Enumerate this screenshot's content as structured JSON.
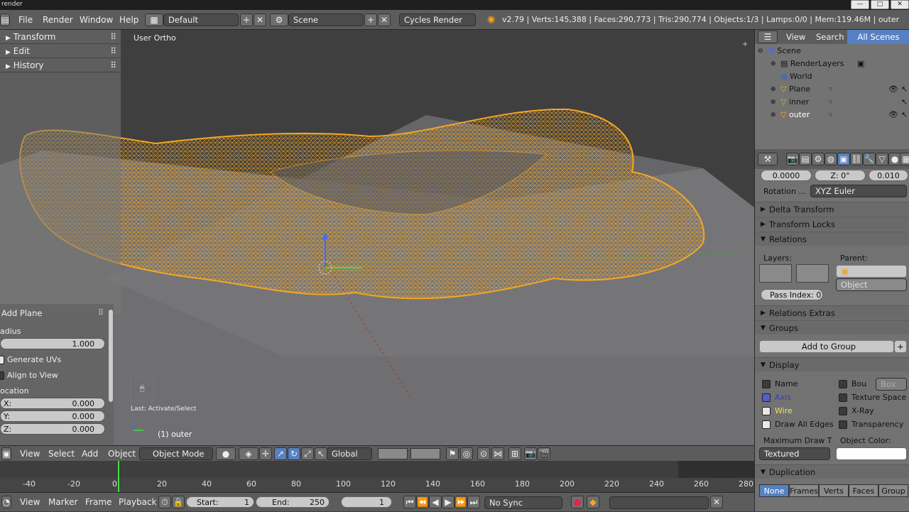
{
  "titlebar": {
    "title": "render"
  },
  "window_buttons": [
    "—",
    "□",
    "✕"
  ],
  "menu": {
    "file": "File",
    "render": "Render",
    "window": "Window",
    "help": "Help"
  },
  "screen_layout": "Default",
  "scene_name": "Scene",
  "render_engine": "Cycles Render",
  "stats": "v2.79 | Verts:145,388 | Faces:290,773 | Tris:290,774 | Objects:1/3 | Lamps:0/0 | Mem:119.46M | outer",
  "toolshelf": {
    "items": [
      "Transform",
      "Edit",
      "History"
    ]
  },
  "viewport": {
    "view_name": "User Ortho",
    "last_op": "Last: Activate/Select",
    "object_label": "(1) outer"
  },
  "redo_panel": {
    "title": "Add Plane",
    "radius_label": "adius",
    "radius_value": "1.000",
    "generate_uvs": "Generate UVs",
    "align_to_view": "Align to View",
    "location_label": "ocation",
    "x_label": "X:",
    "x_value": "0.000",
    "y_label": "Y:",
    "y_value": "0.000",
    "z_label": "Z:",
    "z_value": "0.000"
  },
  "header3d": {
    "view": "View",
    "select": "Select",
    "add": "Add",
    "object": "Object",
    "mode": "Object Mode",
    "orientation": "Global"
  },
  "timeline": {
    "ticks": [
      "-40",
      "-20",
      "0",
      "20",
      "40",
      "60",
      "80",
      "100",
      "120",
      "140",
      "160",
      "180",
      "200",
      "220",
      "240",
      "260",
      "280"
    ],
    "current_frame_value": 0
  },
  "tlheader": {
    "view": "View",
    "marker": "Marker",
    "frame": "Frame",
    "playback": "Playback",
    "start_label": "Start:",
    "start_value": "1",
    "end_label": "End:",
    "end_value": "250",
    "current": "1",
    "sync": "No Sync"
  },
  "outliner": {
    "view": "View",
    "search": "Search",
    "scope": "All Scenes",
    "items": [
      {
        "name": "Scene",
        "icon": "scene-icon"
      },
      {
        "name": "RenderLayers",
        "icon": "renderlayers-icon"
      },
      {
        "name": "World",
        "icon": "world-icon"
      },
      {
        "name": "Plane",
        "icon": "mesh-object-icon"
      },
      {
        "name": "inner",
        "icon": "mesh-object-icon"
      },
      {
        "name": "outer",
        "icon": "mesh-object-icon"
      }
    ]
  },
  "properties": {
    "scale_x": "0.0000",
    "rot_z_label": "Z:",
    "rot_z_value": "0°",
    "scale_z": "0.010",
    "rotation_label": "Rotation ...",
    "rotation_mode": "XYZ Euler",
    "panels": {
      "delta": "Delta Transform",
      "locks": "Transform Locks",
      "relations": "Relations",
      "relations_extras": "Relations Extras",
      "groups": "Groups",
      "display": "Display",
      "duplication": "Duplication"
    },
    "layers_label": "Layers:",
    "parent_label": "Parent:",
    "parent_type": "Object",
    "pass_index_label": "Pass Index:",
    "pass_index_value": "0",
    "add_to_group": "Add to Group",
    "display": {
      "name": "Name",
      "axis": "Axis",
      "wire": "Wire",
      "draw_all_edges": "Draw All Edges",
      "bounds": "Bou",
      "bounds_type": "Box",
      "texture_space": "Texture Space",
      "xray": "X-Ray",
      "transparency": "Transparency",
      "max_draw_label": "Maximum Draw T",
      "max_draw_value": "Textured",
      "object_color_label": "Object Color:"
    },
    "duplication_options": [
      "None",
      "Frames",
      "Verts",
      "Faces",
      "Group"
    ],
    "duplication_selected": "None"
  },
  "colors": {
    "accent": "#5680c2",
    "selection": "#f5a623",
    "background": "#3d3d3d"
  }
}
